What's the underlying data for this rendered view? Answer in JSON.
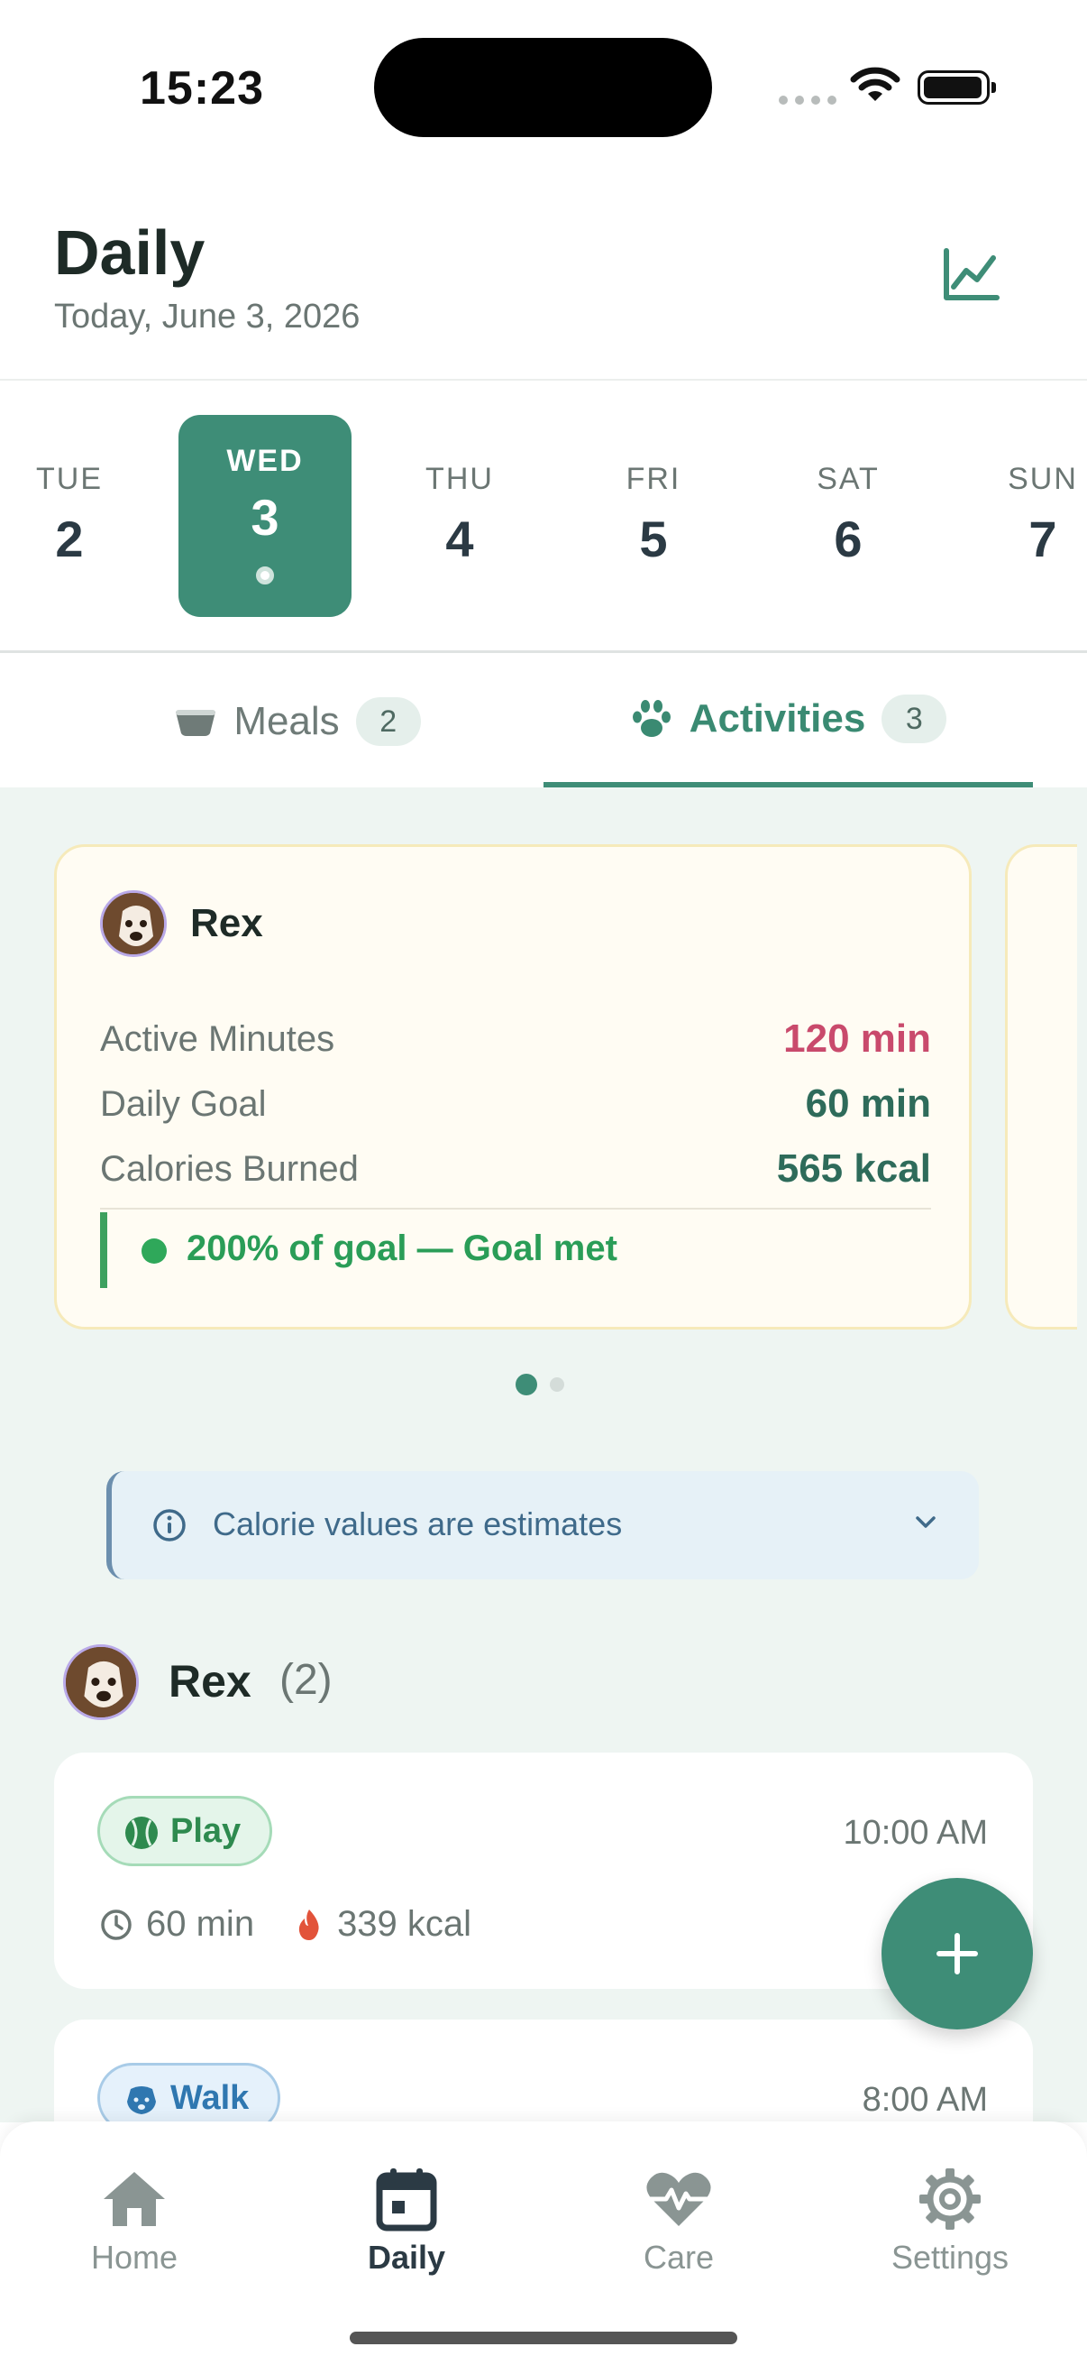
{
  "status_bar": {
    "time": "15:23"
  },
  "header": {
    "title": "Daily",
    "subtitle": "Today, June 3, 2026",
    "chart_icon": "line-chart-icon"
  },
  "days": [
    {
      "name": "TUE",
      "num": "2"
    },
    {
      "name": "WED",
      "num": "3",
      "selected": true
    },
    {
      "name": "THU",
      "num": "4"
    },
    {
      "name": "FRI",
      "num": "5"
    },
    {
      "name": "SAT",
      "num": "6"
    },
    {
      "name": "SUN",
      "num": "7"
    }
  ],
  "tabs": {
    "meals": {
      "label": "Meals",
      "count": "2"
    },
    "activities": {
      "label": "Activities",
      "count": "3",
      "active": true
    }
  },
  "summary": {
    "pet_name": "Rex",
    "active_minutes_label": "Active Minutes",
    "active_minutes_value": "120 min",
    "daily_goal_label": "Daily Goal",
    "daily_goal_value": "60 min",
    "calories_label": "Calories Burned",
    "calories_value": "565 kcal",
    "goal_status": "200% of goal — Goal met",
    "page_index": 1,
    "page_count": 2
  },
  "info_banner": {
    "text": "Calorie values are estimates"
  },
  "group": {
    "name": "Rex",
    "count": "(2)"
  },
  "activities": [
    {
      "type": "Play",
      "time": "10:00 AM",
      "duration": "60 min",
      "calories": "339 kcal"
    },
    {
      "type": "Walk",
      "time": "8:00 AM"
    }
  ],
  "nav": {
    "home": "Home",
    "daily": "Daily",
    "care": "Care",
    "settings": "Settings",
    "active": "daily"
  },
  "colors": {
    "accent": "#3e8d77",
    "over_goal": "#c94a6c",
    "goal_met": "#2a9d57",
    "info": "#3f6a8a"
  }
}
